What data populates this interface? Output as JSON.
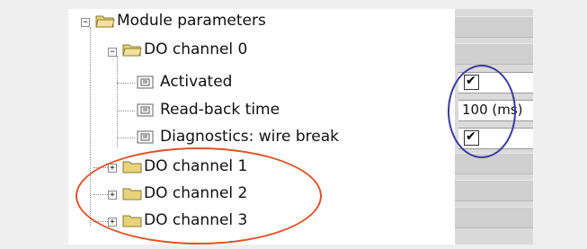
{
  "tree": {
    "root": {
      "label": "Module parameters",
      "expander": "−"
    },
    "channel0": {
      "label": "DO channel 0",
      "expander": "−"
    },
    "params": [
      {
        "label": "Activated",
        "icon": "parameter-icon"
      },
      {
        "label": "Read-back time",
        "icon": "parameter-icon"
      },
      {
        "label": "Diagnostics: wire break",
        "icon": "parameter-icon"
      }
    ],
    "channels": [
      {
        "label": "DO channel 1",
        "expander": "+"
      },
      {
        "label": "DO channel 2",
        "expander": "+"
      },
      {
        "label": "DO channel 3",
        "expander": "+"
      }
    ]
  },
  "values": {
    "activated": {
      "checked": true,
      "mark": "✔"
    },
    "read_back_time": "100 (ms)",
    "wire_break": {
      "checked": true,
      "mark": "✔"
    }
  },
  "colors": {
    "folder": "#e8d27a",
    "highlight_blue": "#3a3aa0",
    "highlight_red": "#e0522a"
  }
}
